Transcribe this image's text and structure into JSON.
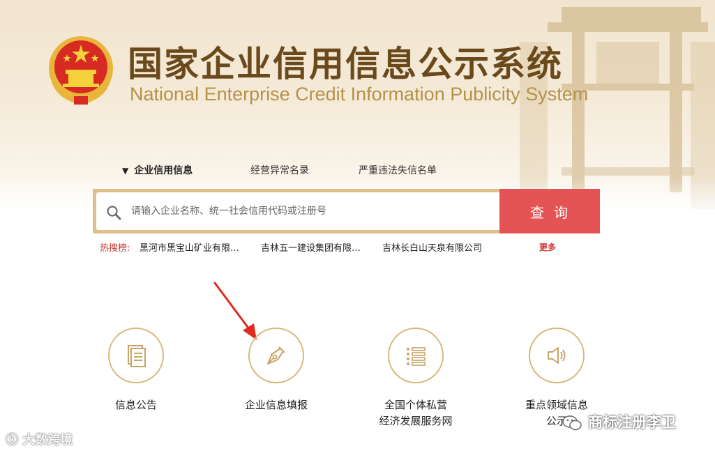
{
  "header": {
    "title": "国家企业信用信息公示系统",
    "subtitle": "National Enterprise Credit Information Publicity System",
    "emblem_icon": "national-emblem-icon"
  },
  "search": {
    "tabs": [
      {
        "label": "企业信用信息",
        "active": true
      },
      {
        "label": "经营异常名录",
        "active": false
      },
      {
        "label": "严重违法失信名单",
        "active": false
      }
    ],
    "placeholder": "请输入企业名称、统一社会信用代码或注册号",
    "value": "",
    "button_label": "查询",
    "hot_label": "热搜榜:",
    "hot_items": [
      "黑河市黑宝山矿业有限…",
      "吉林五一建设集团有限…",
      "吉林长白山天泉有限公司"
    ],
    "more_label": "更多"
  },
  "features": [
    {
      "label": "信息公告",
      "icon": "document-icon"
    },
    {
      "label": "企业信息填报",
      "icon": "pen-nib-icon"
    },
    {
      "label_line1": "全国个体私营",
      "label_line2": "经济发展服务网",
      "icon": "list-icon"
    },
    {
      "label_line1": "重点领域信息",
      "label_line2": "公示",
      "icon": "speaker-icon"
    }
  ],
  "watermarks": {
    "left": "大数跨境",
    "right": "商标注册李卫"
  },
  "colors": {
    "accent_gold": "#d8b779",
    "search_button": "#e45454",
    "title_brown": "#6a4a1c",
    "subtitle_gold": "#b3924a",
    "hot_label_red": "#c0392b"
  }
}
